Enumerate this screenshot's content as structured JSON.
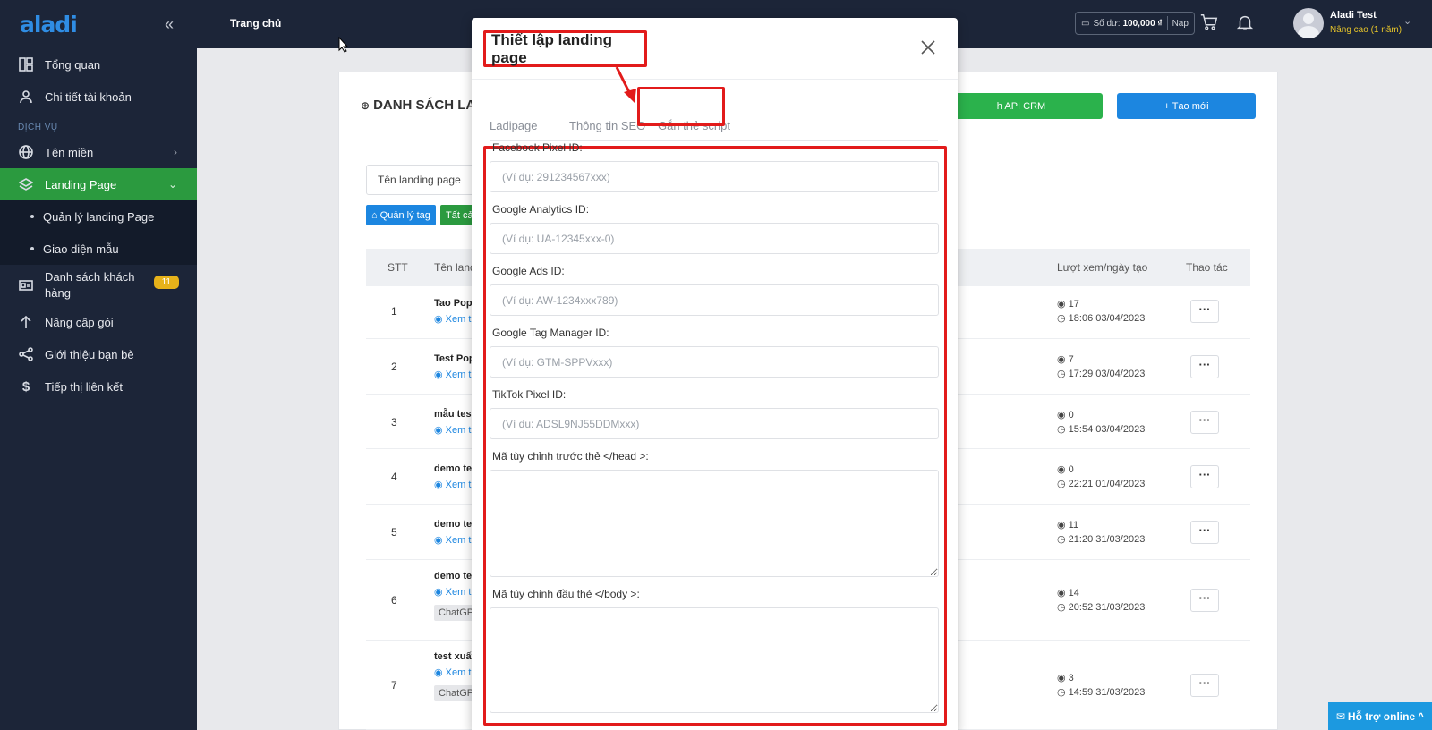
{
  "sidebar": {
    "logo": "aladi",
    "collapse_icon": "double-chevron-left-icon",
    "items": [
      {
        "label": "Tổng quan",
        "icon": "dashboard-icon"
      },
      {
        "label": "Chi tiết tài khoản",
        "icon": "user-icon"
      }
    ],
    "section_label": "DỊCH VỤ",
    "domain_item": {
      "label": "Tên miền",
      "icon": "globe-icon"
    },
    "landing_item": {
      "label": "Landing Page",
      "icon": "layers-icon"
    },
    "sub_items": [
      {
        "label": "Quản lý landing Page"
      },
      {
        "label": "Giao diện mẫu"
      }
    ],
    "customers_item": {
      "label": "Danh sách khách hàng",
      "badge": "11",
      "icon": "id-card-icon"
    },
    "bottom_items": [
      {
        "label": "Nâng cấp gói",
        "icon": "arrow-up-icon"
      },
      {
        "label": "Giới thiệu bạn bè",
        "icon": "share-icon"
      },
      {
        "label": "Tiếp thị liên kết",
        "icon": "dollar-icon"
      }
    ]
  },
  "header": {
    "home": "Trang chủ",
    "balance_label": "Số dư:",
    "balance_value": "100,000 ₫",
    "topup": "Nạp",
    "user_name": "Aladi Test",
    "user_plan": "Nâng cao (1 năm)"
  },
  "background": {
    "title": "DANH SÁCH LA",
    "api_button": "h API CRM",
    "new_button": "+ Tạo mới",
    "search_value": "Tên landing page",
    "tag_manage": "Quản lý tag",
    "tag_all": "Tất cả",
    "columns": {
      "stt": "STT",
      "name": "Tên land",
      "views": "Lượt xem/ngày tạo",
      "actions": "Thao tác"
    },
    "rows": [
      {
        "stt": "1",
        "name": "Tao Pop",
        "link": "Xem t",
        "chip": "",
        "views": "17",
        "date": "18:06 03/04/2023"
      },
      {
        "stt": "2",
        "name": "Test Pop",
        "link": "Xem t",
        "chip": "",
        "views": "7",
        "date": "17:29 03/04/2023"
      },
      {
        "stt": "3",
        "name": "mẫu test",
        "link": "Xem t",
        "chip": "",
        "views": "0",
        "date": "15:54 03/04/2023"
      },
      {
        "stt": "4",
        "name": "demo te",
        "link": "Xem t",
        "chip": "",
        "views": "0",
        "date": "22:21 01/04/2023"
      },
      {
        "stt": "5",
        "name": "demo te",
        "link": "Xem t",
        "chip": "",
        "views": "11",
        "date": "21:20 31/03/2023"
      },
      {
        "stt": "6",
        "name": "demo te",
        "link": "Xem t",
        "chip": "ChatGP",
        "views": "14",
        "date": "20:52 31/03/2023"
      },
      {
        "stt": "7",
        "name": "test xuất",
        "link": "Xem t",
        "chip": "ChatGP",
        "views": "3",
        "date": "14:59 31/03/2023"
      }
    ],
    "action_label": "···"
  },
  "modal": {
    "title": "Thiết lập landing page",
    "tabs": [
      {
        "label": "Ladipage"
      },
      {
        "label": "Thông tin SEO"
      },
      {
        "label": "Gắn thẻ script"
      }
    ],
    "fields": [
      {
        "label": "Facebook Pixel ID:",
        "placeholder": "(Ví dụ: 291234567xxx)"
      },
      {
        "label": "Google Analytics ID:",
        "placeholder": "(Ví dụ: UA-12345xxx-0)"
      },
      {
        "label": "Google Ads ID:",
        "placeholder": "(Ví dụ: AW-1234xxx789)"
      },
      {
        "label": "Google Tag Manager ID:",
        "placeholder": "(Ví dụ: GTM-SPPVxxx)"
      },
      {
        "label": "TikTok Pixel ID:",
        "placeholder": "(Ví dụ: ADSL9NJ55DDMxxx)"
      }
    ],
    "head_label": "Mã tùy chỉnh trước thẻ </head >:",
    "body_label": "Mã tùy chỉnh đầu thẻ </body >:"
  },
  "support": "Hỗ trợ online",
  "colors": {
    "sidebar": "#1c2538",
    "active": "#2b9a3f",
    "highlight": "#e21b1b",
    "primary": "#1c86e0"
  }
}
